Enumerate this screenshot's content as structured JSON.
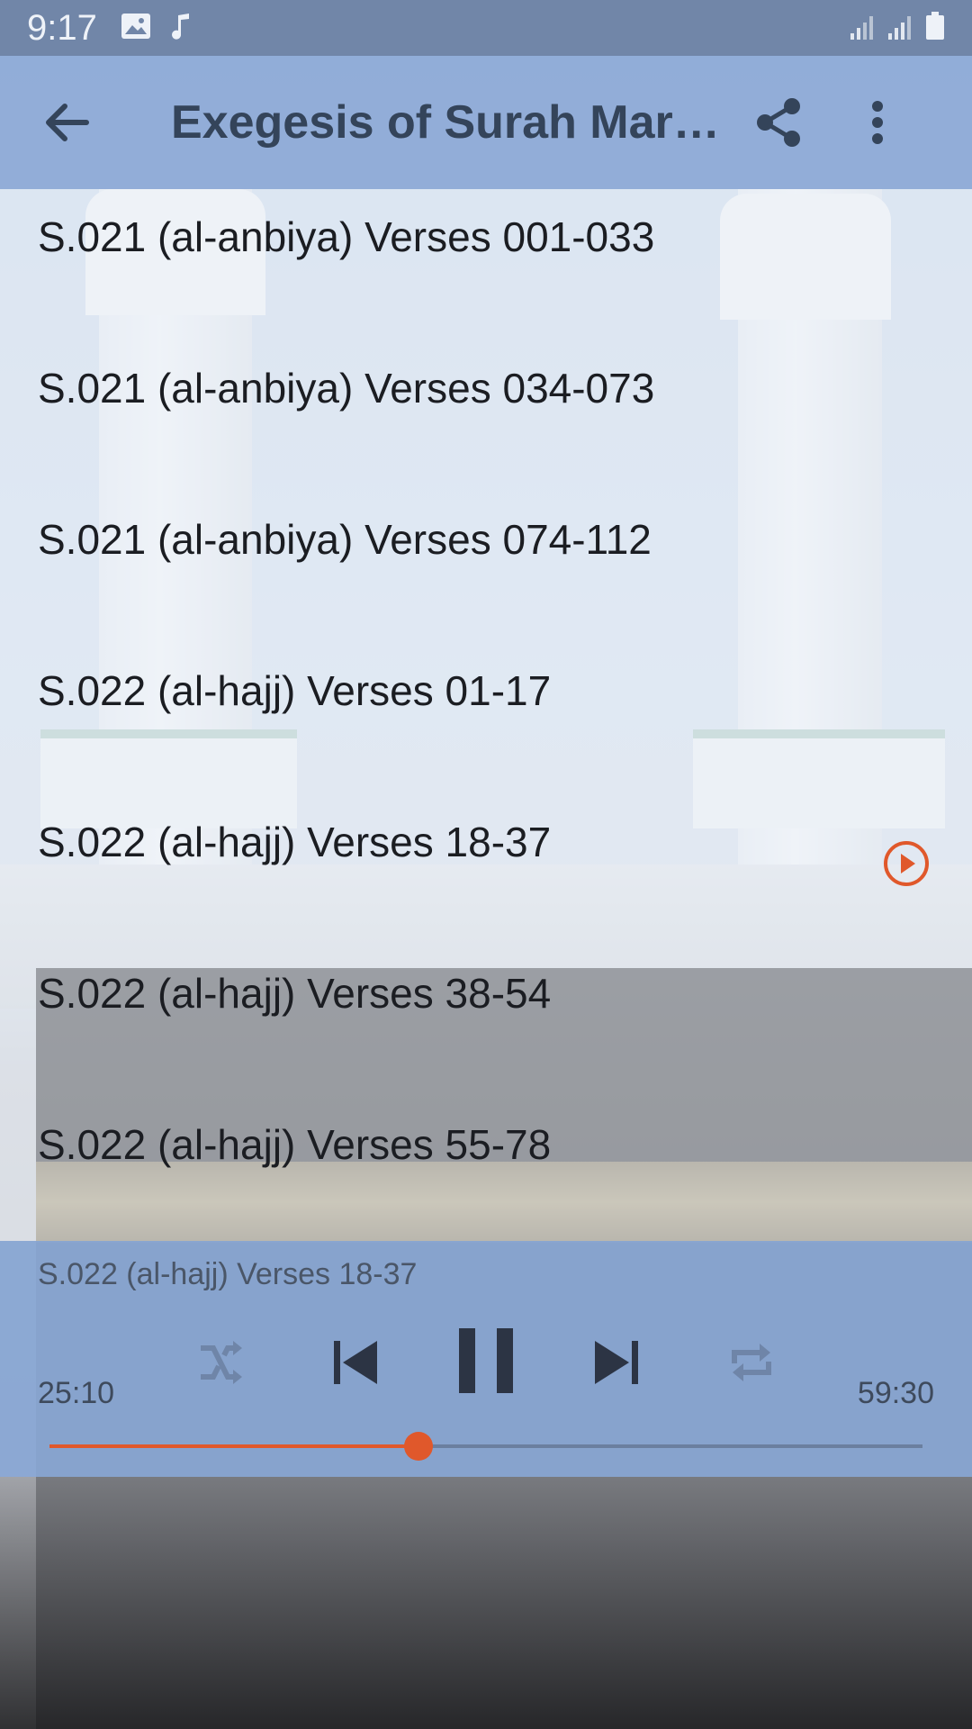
{
  "status_bar": {
    "time": "9:17",
    "icons": [
      "image-icon",
      "music-note-icon",
      "signal-icon",
      "signal-icon",
      "battery-icon"
    ]
  },
  "app_bar": {
    "title": "Exegesis of Surah Marya...",
    "back_icon": "arrow-left-icon",
    "share_icon": "share-icon",
    "more_icon": "more-vertical-icon"
  },
  "list": {
    "items": [
      {
        "label": "S.021 (al-anbiya) Verses 001-033"
      },
      {
        "label": "S.021 (al-anbiya) Verses 034-073"
      },
      {
        "label": "S.021 (al-anbiya) Verses 074-112"
      },
      {
        "label": "S.022 (al-hajj) Verses 01-17"
      },
      {
        "label": "S.022 (al-hajj) Verses 18-37",
        "playing": true
      },
      {
        "label": "S.022 (al-hajj) Verses 38-54"
      },
      {
        "label": "S.022 (al-hajj) Verses 55-78"
      }
    ]
  },
  "player": {
    "now_playing": "S.022 (al-hajj) Verses 18-37",
    "current_time": "25:10",
    "total_time": "59:30",
    "progress_fraction": 0.423,
    "controls": [
      "shuffle-icon",
      "skip-previous-icon",
      "pause-icon",
      "skip-next-icon",
      "repeat-icon"
    ]
  },
  "colors": {
    "accent": "#e0582b",
    "app_bar": "#8daad6",
    "status_bar": "#7186a8",
    "title_text": "#34445a"
  }
}
